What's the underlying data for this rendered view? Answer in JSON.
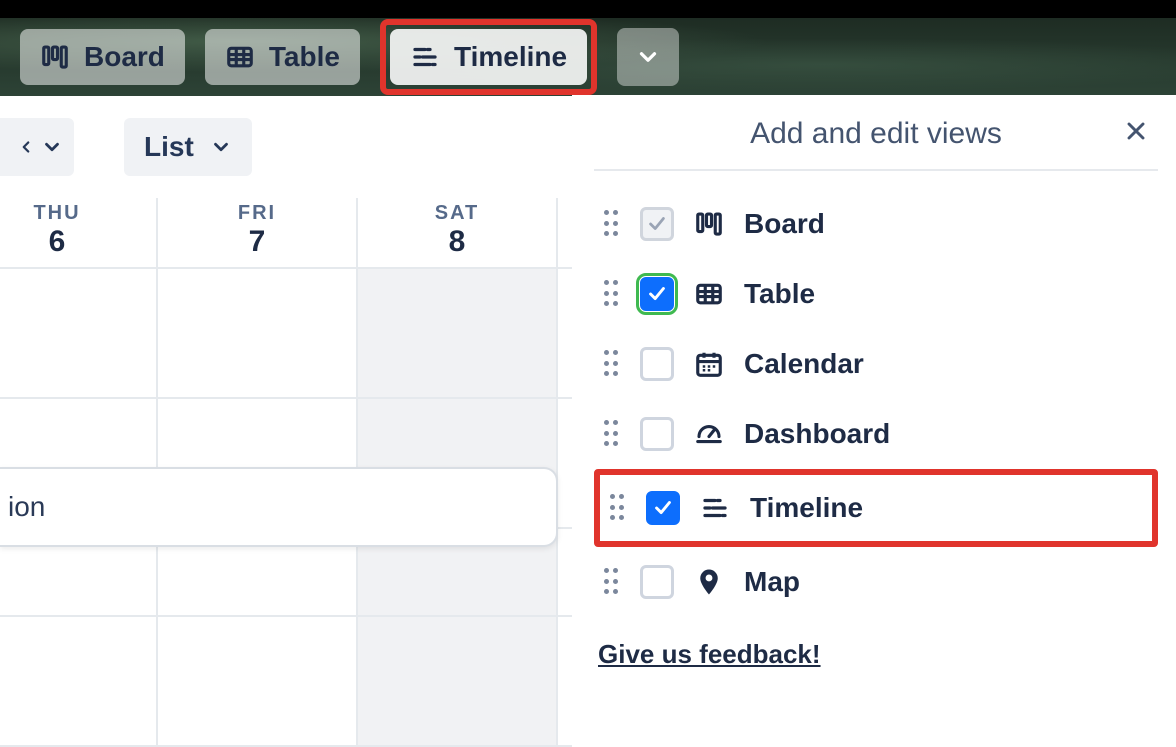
{
  "toolbar": {
    "board_label": "Board",
    "table_label": "Table",
    "timeline_label": "Timeline"
  },
  "controls": {
    "list_label": "List"
  },
  "calendar": {
    "days": [
      {
        "dow": "THU",
        "num": "6"
      },
      {
        "dow": "FRI",
        "num": "7"
      },
      {
        "dow": "SAT",
        "num": "8"
      }
    ],
    "event_text": "ion"
  },
  "panel": {
    "title": "Add and edit views",
    "feedback": "Give us feedback!",
    "views": [
      {
        "label": "Board",
        "checked": "disabled",
        "icon": "board"
      },
      {
        "label": "Table",
        "checked": "checked-green",
        "icon": "table"
      },
      {
        "label": "Calendar",
        "checked": "unchecked",
        "icon": "calendar"
      },
      {
        "label": "Dashboard",
        "checked": "unchecked",
        "icon": "dashboard"
      },
      {
        "label": "Timeline",
        "checked": "checked",
        "icon": "timeline"
      },
      {
        "label": "Map",
        "checked": "unchecked",
        "icon": "map"
      }
    ]
  }
}
